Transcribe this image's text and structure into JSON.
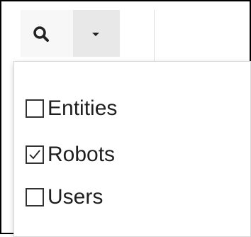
{
  "toolbar": {
    "search_icon": "search-icon",
    "dropdown_icon": "caret-down-icon"
  },
  "menu": {
    "items": [
      {
        "label": "Entities",
        "checked": false
      },
      {
        "label": "Robots",
        "checked": true
      },
      {
        "label": "Users",
        "checked": false
      }
    ]
  },
  "colors": {
    "search_bg": "#f7f7f7",
    "dropdown_bg": "#e8e8e8",
    "text": "#1f1f1f"
  }
}
